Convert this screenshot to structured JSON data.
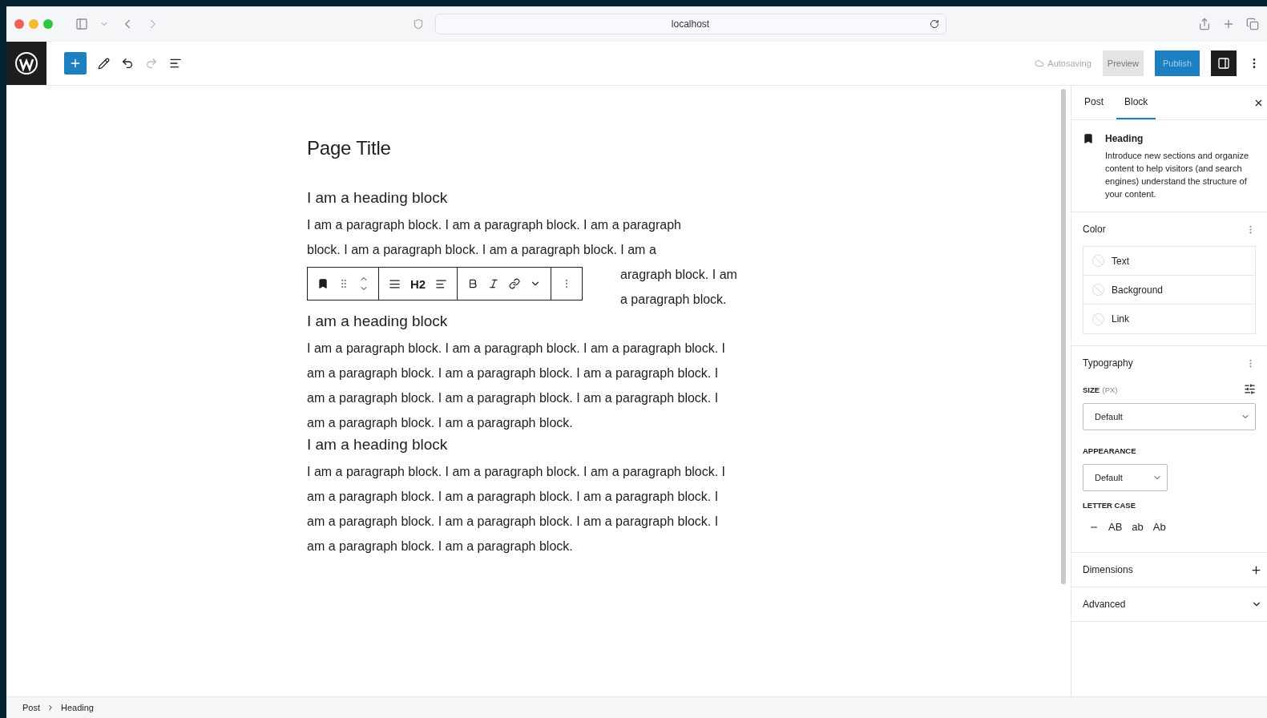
{
  "browser": {
    "address": "localhost"
  },
  "top_bar": {
    "status": "Autosaving",
    "preview": "Preview",
    "publish": "Publish"
  },
  "block_toolbar": {
    "level": "H2"
  },
  "content": {
    "title": "Page Title",
    "blocks": [
      {
        "kind": "heading",
        "text": "I am a heading block"
      },
      {
        "kind": "partial",
        "lines": [
          "I am a paragraph block. I am a paragraph block. I am a paragraph",
          "block. I am a paragraph block. I am a paragraph block. I am a",
          "aragraph block. I am",
          "a paragraph block."
        ]
      },
      {
        "kind": "heading",
        "text": "I am a heading block"
      },
      {
        "kind": "paragraph",
        "text": "I am a paragraph block. I am a paragraph block. I am a paragraph block. I am a paragraph block. I am a paragraph block. I am a paragraph block. I am a paragraph block. I am a paragraph block. I am a paragraph block. I am a paragraph block. I am a paragraph block."
      },
      {
        "kind": "heading",
        "text": "I am a heading block"
      },
      {
        "kind": "paragraph",
        "text": "I am a paragraph block. I am a paragraph block. I am a paragraph block. I am a paragraph block. I am a paragraph block. I am a paragraph block. I am a paragraph block. I am a paragraph block. I am a paragraph block. I am a paragraph block. I am a paragraph block."
      }
    ]
  },
  "sidebar": {
    "tabs": [
      {
        "label": "Post",
        "selected": false
      },
      {
        "label": "Block",
        "selected": true
      }
    ],
    "block_card": {
      "title": "Heading",
      "description": "Introduce new sections and organize content to help visitors (and search engines) understand the structure of your content."
    },
    "color": {
      "title": "Color",
      "items": [
        "Text",
        "Background",
        "Link"
      ]
    },
    "typography": {
      "title": "Typography",
      "size_label": "SIZE",
      "size_unit": "(PX)",
      "size_value": "Default",
      "appearance_label": "APPEARANCE",
      "appearance_value": "Default",
      "letter_case_label": "LETTER CASE",
      "letter_case_options": [
        "AB",
        "ab",
        "Ab"
      ]
    },
    "panels": [
      {
        "title": "Dimensions",
        "kind": "add"
      },
      {
        "title": "Advanced",
        "kind": "expand"
      }
    ]
  },
  "breadcrumb": [
    "Post",
    "Heading"
  ]
}
